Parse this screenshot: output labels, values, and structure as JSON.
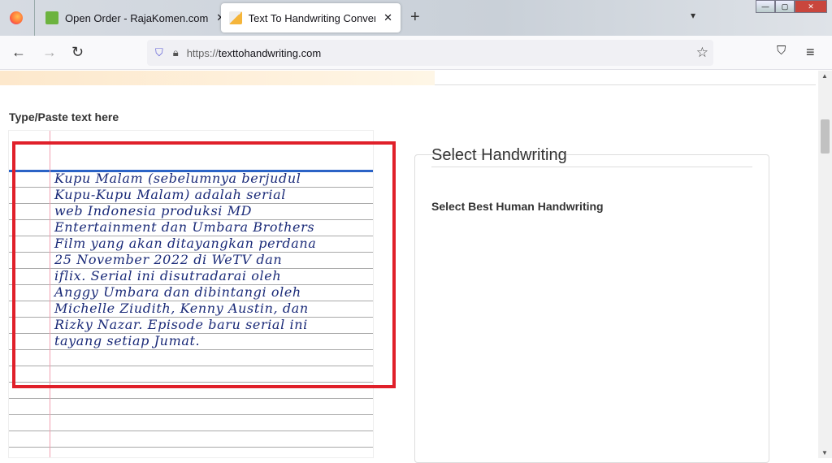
{
  "browser": {
    "tabs": [
      {
        "title": "Open Order - RajaKomen.com",
        "active": false,
        "icon": "rajakomen-icon"
      },
      {
        "title": "Text To Handwriting Converter -",
        "active": true,
        "icon": "pencil-note-icon"
      }
    ],
    "url_prefix": "https://",
    "url_domain": "texttohandwriting.com"
  },
  "page": {
    "input_label": "Type/Paste text here",
    "handwriting_lines": [
      "Kupu Malam (sebelumnya berjudul",
      "Kupu-Kupu Malam) adalah serial",
      "web Indonesia produksi MD",
      "Entertainment dan Umbara Brothers",
      "Film yang akan ditayangkan perdana",
      "25 November 2022 di WeTV dan",
      "iflix. Serial ini disutradarai oleh",
      "Anggy Umbara dan dibintangi oleh",
      "Michelle Ziudith, Kenny Austin, dan",
      "Rizky Nazar. Episode baru serial ini",
      "tayang setiap Jumat."
    ],
    "panel_title": "Select Handwriting",
    "panel_subtitle": "Select Best Human Handwriting",
    "highlight_color": "#e0202a"
  }
}
